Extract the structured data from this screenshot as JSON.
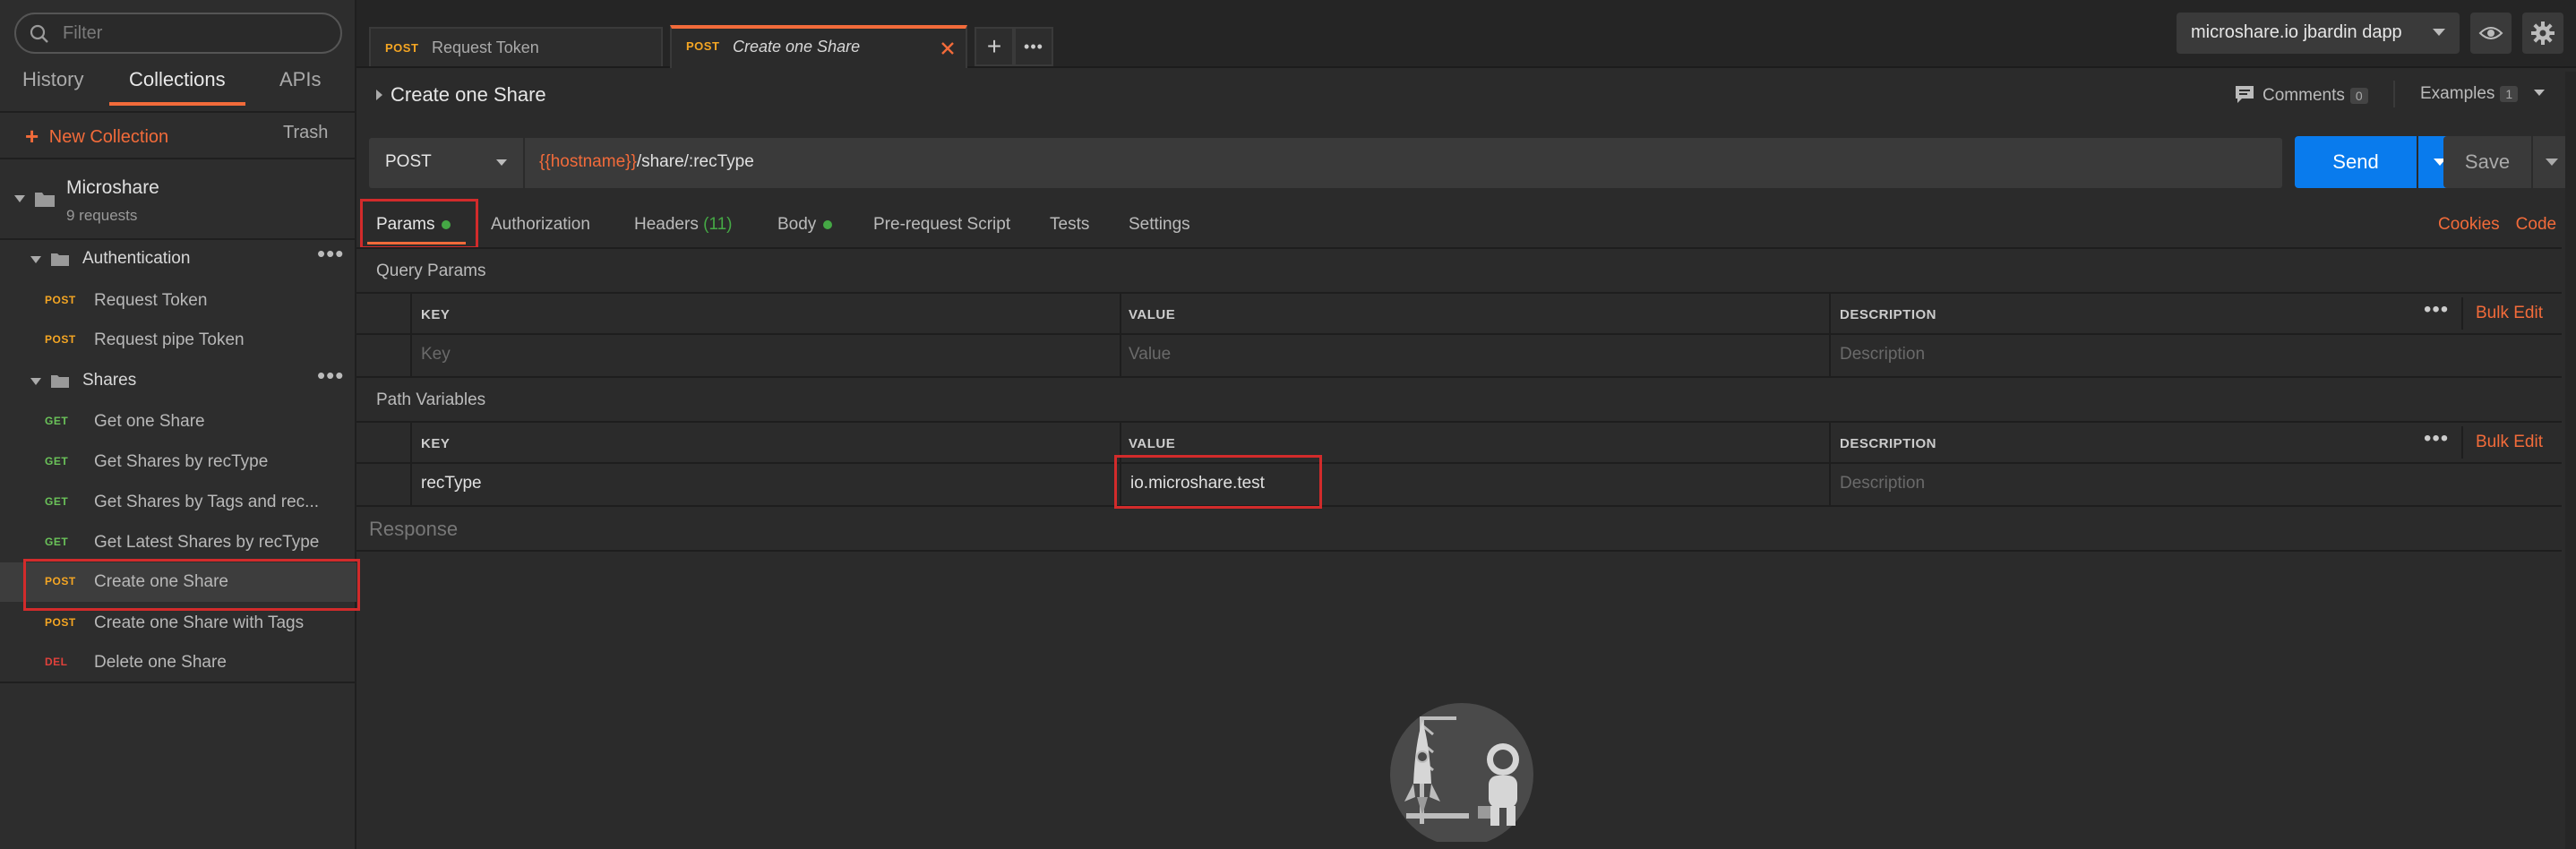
{
  "sidebar": {
    "filter_placeholder": "Filter",
    "tabs": [
      "History",
      "Collections",
      "APIs"
    ],
    "new_collection": "New Collection",
    "trash": "Trash",
    "collection": {
      "name": "Microshare",
      "count": "9 requests"
    },
    "folders": [
      {
        "name": "Authentication",
        "requests": [
          {
            "method": "POST",
            "name": "Request Token"
          },
          {
            "method": "POST",
            "name": "Request pipe Token"
          }
        ]
      },
      {
        "name": "Shares",
        "requests": [
          {
            "method": "GET",
            "name": "Get one Share"
          },
          {
            "method": "GET",
            "name": "Get Shares by recType"
          },
          {
            "method": "GET",
            "name": "Get Shares by Tags and rec..."
          },
          {
            "method": "GET",
            "name": "Get Latest Shares by recType"
          },
          {
            "method": "POST",
            "name": "Create one Share"
          },
          {
            "method": "POST",
            "name": "Create one Share with Tags"
          },
          {
            "method": "DEL",
            "name": "Delete one Share"
          }
        ]
      }
    ]
  },
  "tabs": [
    {
      "method": "POST",
      "name": "Request Token"
    },
    {
      "method": "POST",
      "name": "Create one Share"
    }
  ],
  "environment": "microshare.io jbardin dapp",
  "request": {
    "title": "Create one Share",
    "comments_label": "Comments",
    "comments_count": "0",
    "examples_label": "Examples",
    "examples_count": "1",
    "method": "POST",
    "url_var": "{{hostname}}",
    "url_rest": "/share/:recType",
    "send": "Send",
    "save": "Save"
  },
  "req_tabs": {
    "params": "Params",
    "authorization": "Authorization",
    "headers": "Headers",
    "headers_count": "(11)",
    "body": "Body",
    "prerequest": "Pre-request Script",
    "tests": "Tests",
    "settings": "Settings",
    "cookies": "Cookies",
    "code": "Code"
  },
  "query_params": {
    "title": "Query Params",
    "headers": [
      "KEY",
      "VALUE",
      "DESCRIPTION"
    ],
    "bulk_edit": "Bulk Edit",
    "placeholder": {
      "key": "Key",
      "value": "Value",
      "description": "Description"
    }
  },
  "path_variables": {
    "title": "Path Variables",
    "headers": [
      "KEY",
      "VALUE",
      "DESCRIPTION"
    ],
    "bulk_edit": "Bulk Edit",
    "row": {
      "key": "recType",
      "value": "io.microshare.test",
      "description": "Description"
    }
  },
  "response_label": "Response",
  "colors": {
    "accent": "#f26b3a",
    "send": "#097bed",
    "post": "#f5a623",
    "get": "#6ac259",
    "del": "#e0413b",
    "highlight": "#d22b2b"
  }
}
